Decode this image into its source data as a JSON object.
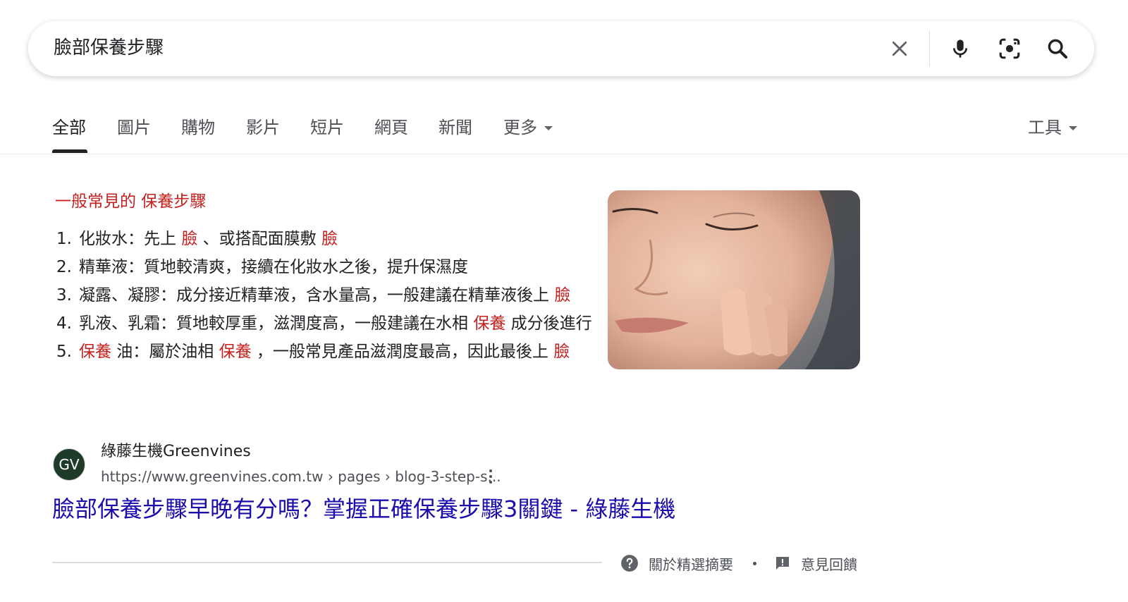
{
  "search": {
    "query": "臉部保養步驟"
  },
  "tabs": [
    {
      "label": "全部"
    },
    {
      "label": "圖片"
    },
    {
      "label": "購物"
    },
    {
      "label": "影片"
    },
    {
      "label": "短片"
    },
    {
      "label": "網頁"
    },
    {
      "label": "新聞"
    },
    {
      "label": "更多"
    }
  ],
  "tools_label": "工具",
  "snippet": {
    "heading": "一般常見的 保養步驟",
    "items": [
      {
        "num": "1.",
        "parts": [
          "化妝水：先上 ",
          "臉",
          " 、或搭配面膜敷 ",
          "臉"
        ]
      },
      {
        "num": "2.",
        "parts": [
          "精華液：質地較清爽，接續在化妝水之後，提升保濕度"
        ]
      },
      {
        "num": "3.",
        "parts": [
          "凝露、凝膠：成分接近精華液，含水量高，一般建議在精華液後上 ",
          "臉"
        ]
      },
      {
        "num": "4.",
        "parts": [
          "乳液、乳霜：質地較厚重，滋潤度高，一般建議在水相 ",
          "保養",
          " 成分後進行"
        ]
      },
      {
        "num": "5.",
        "parts": [
          "",
          "保養",
          " 油：屬於油相 ",
          "保養",
          " ，一般常見產品滋潤度最高，因此最後上 ",
          "臉"
        ]
      }
    ]
  },
  "result": {
    "favicon_text": "GV",
    "site_name": "綠藤生機Greenvines",
    "url": "https://www.greenvines.com.tw › pages › blog-3-step-s...",
    "title": "臉部保養步驟早晚有分嗎？掌握正確保養步驟3關鍵 - 綠藤生機"
  },
  "footer": {
    "about_label": "關於精選摘要",
    "feedback_label": "意見回饋"
  },
  "colors": {
    "link": "#1a0dab",
    "highlight": "#c5221f",
    "text": "#202124",
    "secondary": "#4d5156"
  }
}
